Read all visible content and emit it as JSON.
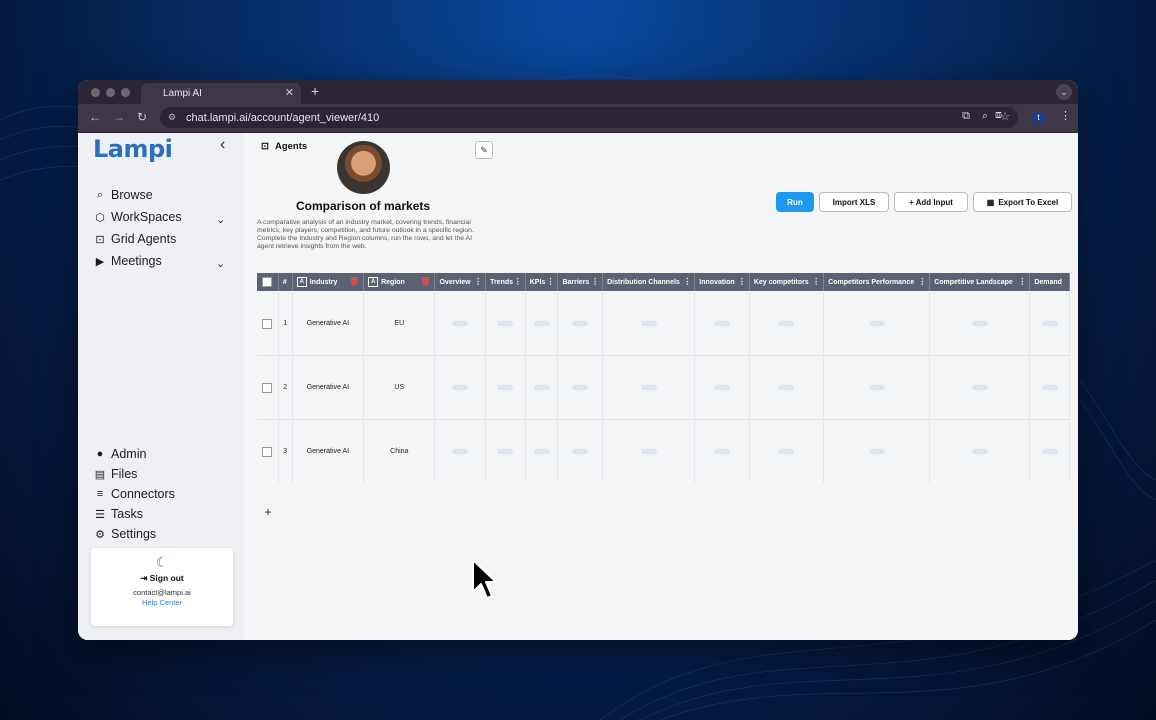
{
  "browser": {
    "tab_title": "Lampi AI",
    "tab_close": "✕",
    "new_tab": "+",
    "url": "chat.lampi.ai/account/agent_viewer/410",
    "profile_initial": "t"
  },
  "sidebar": {
    "logo": "Lampi",
    "collapse": "‹",
    "top_items": [
      {
        "label": "Browse",
        "icon": "search-icon"
      },
      {
        "label": "WorkSpaces",
        "icon": "cube-icon"
      },
      {
        "label": "Grid Agents",
        "icon": "robot-icon"
      },
      {
        "label": "Meetings",
        "icon": "video-icon"
      }
    ],
    "bottom_items": [
      {
        "label": "Admin",
        "icon": "admin-icon"
      },
      {
        "label": "Files",
        "icon": "file-icon"
      },
      {
        "label": "Connectors",
        "icon": "database-icon"
      },
      {
        "label": "Tasks",
        "icon": "tasks-icon"
      },
      {
        "label": "Settings",
        "icon": "gear-icon"
      }
    ],
    "signout": "Sign out",
    "email": "contact@lampi.ai",
    "help": "Help Center"
  },
  "agent": {
    "breadcrumb": "Agents",
    "title": "Comparison of markets",
    "description": "A comparative analysis of an industry market, covering trends, financial metrics, key players, competition, and future outlook in a specific region. Complete the Industry and Region columns, run the rows, and let the AI agent retrieve insights from the web.",
    "buttons": {
      "run": "Run",
      "import": "Import XLS",
      "add_input": "+ Add Input",
      "export": "Export To Excel"
    }
  },
  "table": {
    "headers": [
      "#",
      "Industry",
      "Region",
      "Overview",
      "Trends",
      "KPIs",
      "Barriers",
      "Distribution Channels",
      "Innovation",
      "Key competitors",
      "Competitors Performance",
      "Competitive Landscape",
      "Demand"
    ],
    "rows": [
      {
        "num": "1",
        "industry": "Generative AI",
        "region": "EU"
      },
      {
        "num": "2",
        "industry": "Generative AI",
        "region": "US"
      },
      {
        "num": "3",
        "industry": "Generative AI",
        "region": "China"
      }
    ],
    "add_row": "+"
  }
}
